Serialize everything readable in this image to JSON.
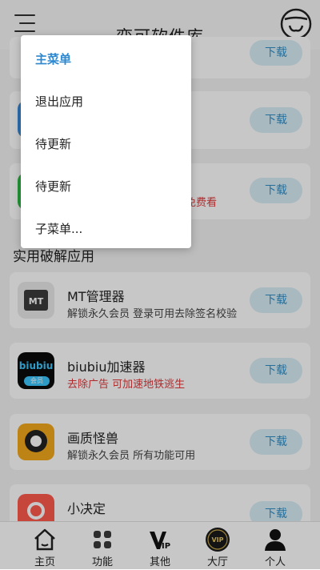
{
  "header": {
    "title": "奕可软件库"
  },
  "cards_top": [
    {
      "download": "下载"
    },
    {
      "download": "下载"
    },
    {
      "desc_tail": "免费看",
      "download": "下载"
    }
  ],
  "section_title": "实用破解应用",
  "apps": [
    {
      "name": "MT管理器",
      "desc": "解锁永久会员 登录可用去除签名校验",
      "desc_color": "normal",
      "download": "下载",
      "icon_text": "MT"
    },
    {
      "name": "biubiu加速器",
      "desc": "去除广告 可加速地铁逃生",
      "desc_color": "red",
      "download": "下载",
      "icon_text": "biubiu",
      "icon_badge": "会员"
    },
    {
      "name": "画质怪兽",
      "desc": "解锁永久会员 所有功能可用",
      "desc_color": "normal",
      "download": "下载"
    },
    {
      "name": "小决定",
      "desc": "",
      "download": "下载"
    }
  ],
  "menu": {
    "items": [
      {
        "label": "主菜单",
        "active": true
      },
      {
        "label": "退出应用"
      },
      {
        "label": "待更新"
      },
      {
        "label": "待更新"
      },
      {
        "label": "子菜单..."
      }
    ]
  },
  "tabbar": {
    "items": [
      {
        "label": "主页",
        "icon": "home-icon"
      },
      {
        "label": "功能",
        "icon": "grid-icon"
      },
      {
        "label": "其他",
        "icon": "vip-icon",
        "icon_text": "IP"
      },
      {
        "label": "大厅",
        "icon": "hall-icon",
        "icon_text": "VIP"
      },
      {
        "label": "个人",
        "icon": "person-icon"
      }
    ]
  },
  "colors": {
    "accent": "#2d88d0",
    "download_bg": "#d9eef7",
    "red": "#e0393b"
  }
}
